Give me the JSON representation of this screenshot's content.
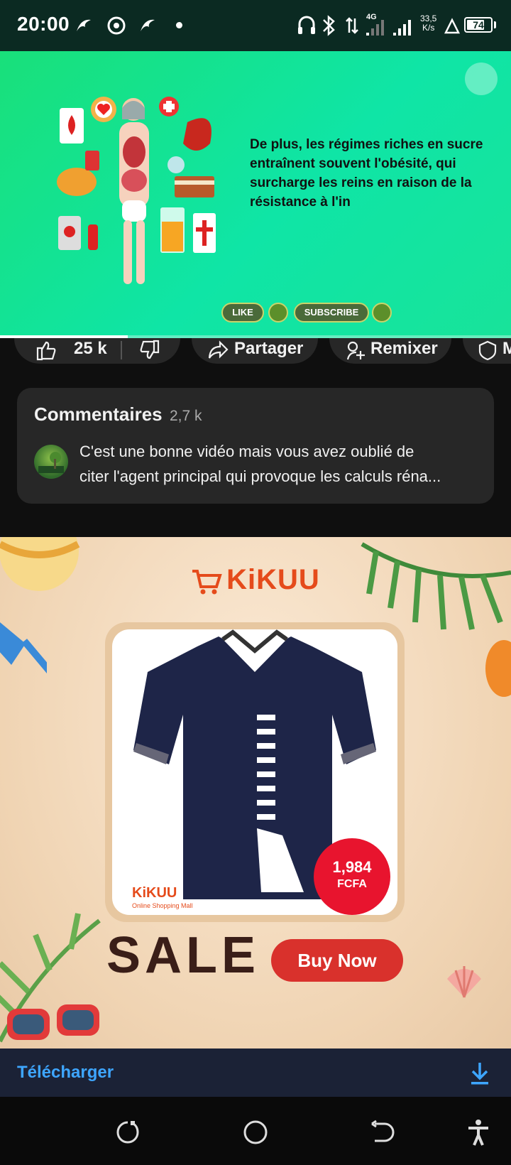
{
  "status_bar": {
    "time": "20:00",
    "network": "4G",
    "speed_value": "33,5",
    "speed_unit": "K/s",
    "battery": "74",
    "battery_level": 0.74
  },
  "video": {
    "caption": "De plus, les régimes riches en sucre entraînent souvent l'obésité, qui surcharge les reins en raison de la résistance à l'in",
    "like_pill": "LIKE",
    "subscribe_pill": "SUBSCRIBE",
    "progress": 0.25
  },
  "actions": {
    "likes": "25 k",
    "share": "Partager",
    "remix": "Remixer",
    "more_partial": "M"
  },
  "comments": {
    "title": "Commentaires",
    "count": "2,7 k",
    "top_comment": "C'est une bonne vidéo mais vous avez oublié de",
    "top_comment_line2": "citer l'agent principal qui provoque les calculs réna..."
  },
  "ad": {
    "brand": "KiKUU",
    "mini_brand": "KiKUU",
    "mini_tagline": "Online Shopping Mall",
    "price": "1,984",
    "currency": "FCFA",
    "sale_text": "SALE",
    "cta": "Buy Now"
  },
  "download_bar": {
    "label": "Télécharger"
  },
  "colors": {
    "accent_blue": "#3ea6ff",
    "video_green": "#0fe5a6",
    "kikuu_orange": "#e54b1b",
    "price_red": "#e8142e"
  }
}
